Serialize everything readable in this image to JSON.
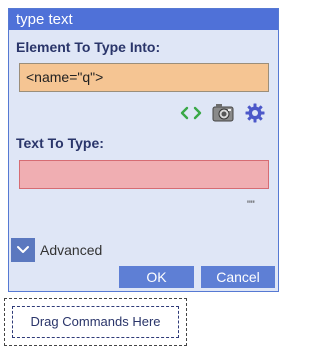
{
  "dialog": {
    "title": "type text",
    "element_label": "Element To Type Into:",
    "element_value": "<name=\"q\">",
    "text_label": "Text To Type:",
    "text_value": "",
    "ellipsis": "\"\"",
    "advanced_label": "Advanced",
    "ok_label": "OK",
    "cancel_label": "Cancel",
    "icons": [
      "code-brackets-icon",
      "camera-icon",
      "gear-icon"
    ]
  },
  "drop_zone": {
    "label": "Drag Commands Here"
  },
  "colors": {
    "title_bar": "#4f71d8",
    "dialog_bg": "#dfe6f6",
    "element_field": "#f5c593",
    "text_field": "#f0aeb2",
    "button": "#5e7fd5"
  }
}
